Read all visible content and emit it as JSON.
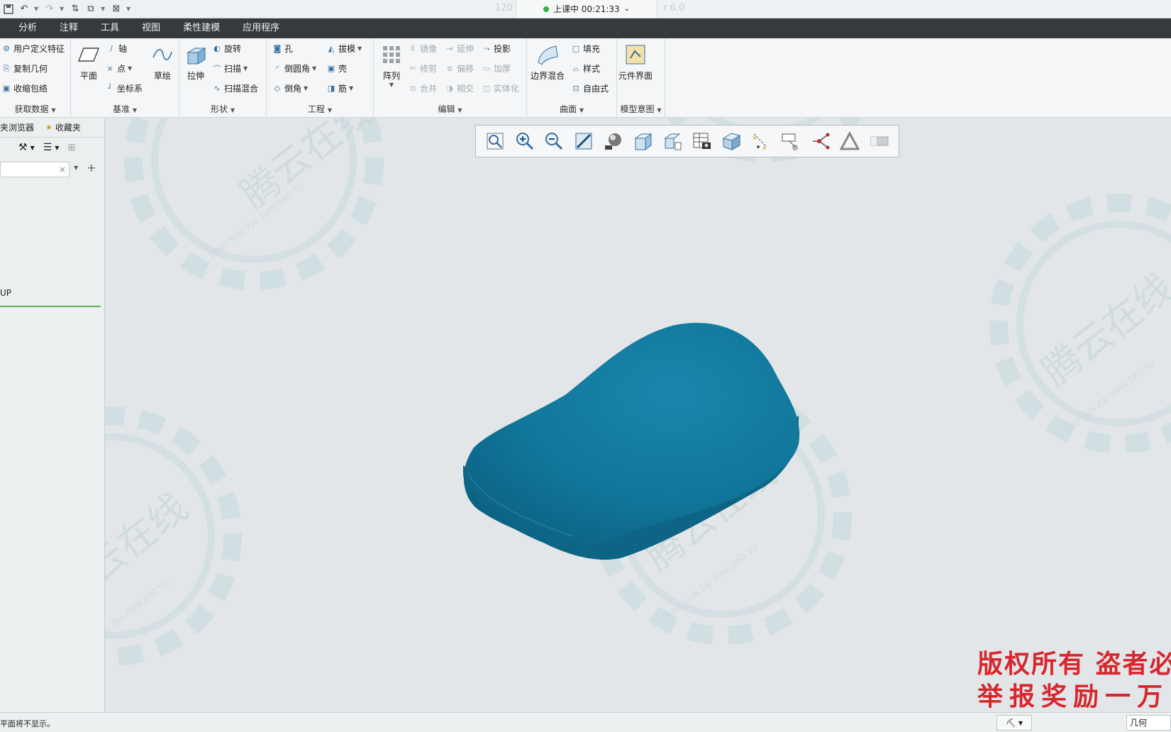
{
  "quick_access": {
    "ghost_left": "120",
    "ghost_right": "r 6.0"
  },
  "class_status": {
    "text": "上课中 00:21:33",
    "chevron": "⌄"
  },
  "menu": {
    "tabs": [
      "分析",
      "注释",
      "工具",
      "视图",
      "柔性建模",
      "应用程序"
    ]
  },
  "ribbon": {
    "get_data": {
      "title": "获取数据",
      "items": [
        "用户定义特征",
        "复制几何",
        "收缩包络"
      ]
    },
    "datum": {
      "title": "基准",
      "plane": "平面",
      "axis": "轴",
      "point": "点",
      "csys": "坐标系",
      "sketch": "草绘"
    },
    "shapes": {
      "title": "形状",
      "extrude": "拉伸",
      "revolve": "旋转",
      "sweep": "扫描",
      "swept_blend": "扫描混合"
    },
    "engineering": {
      "title": "工程",
      "hole": "孔",
      "draft": "拔模",
      "round": "倒圆角",
      "shell": "壳",
      "chamfer": "倒角",
      "rib": "筋"
    },
    "editing": {
      "title": "编辑",
      "pattern": "阵列",
      "mirror": "镜像",
      "extend": "延伸",
      "project": "投影",
      "trim": "修剪",
      "offset": "偏移",
      "thicken": "加厚",
      "merge": "合并",
      "intersect": "相交",
      "solidify": "实体化"
    },
    "surfaces": {
      "title": "曲面",
      "boundary_blend": "边界混合",
      "fill": "填充",
      "style": "样式",
      "freestyle": "自由式"
    },
    "model_intent": {
      "title": "模型意图",
      "component_interface": "元件界面"
    }
  },
  "left_panel": {
    "tabs": [
      "夹浏览器",
      "收藏夹"
    ],
    "search_clear": "×",
    "tree_item": "UP"
  },
  "view_toolbar": {
    "icons": [
      "refit-icon",
      "zoom-in-icon",
      "zoom-out-icon",
      "repaint-icon",
      "display-style-icon",
      "saved-orientations-icon",
      "view-manager-icon",
      "perspective-icon",
      "table-snapshot-icon",
      "section-icon",
      "datum-display-icon",
      "annotation-display-icon",
      "spin-center-icon",
      "appearance-icon",
      "shade-icon"
    ]
  },
  "viewport": {
    "model_color": "#11769a",
    "watermark_text": "腾云在线",
    "watermark_sub": "TENG YUN ZAI XIAN JIAO YU",
    "copyright_line1": "版权所有 盗者必",
    "copyright_line2": "举报奖励一万"
  },
  "status_bar": {
    "message": "平面将不显示。",
    "filter_value": "几何"
  }
}
